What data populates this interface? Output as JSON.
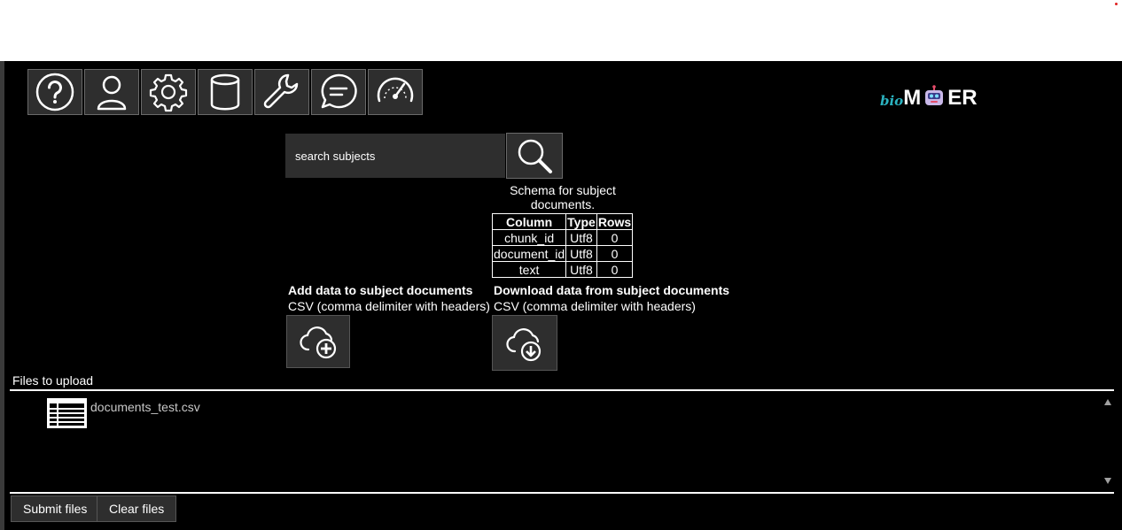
{
  "colors": {
    "background": "#000000",
    "panel": "#2e2e2e",
    "logo_accent": "#2bb3c0"
  },
  "toolbar": {
    "buttons": [
      {
        "icon": "help-icon"
      },
      {
        "icon": "user-icon"
      },
      {
        "icon": "settings-icon"
      },
      {
        "icon": "database-icon"
      },
      {
        "icon": "wrench-icon"
      },
      {
        "icon": "chat-icon"
      },
      {
        "icon": "dashboard-icon"
      }
    ]
  },
  "logo": {
    "prefix": "bio",
    "part1": "M",
    "part2": "ER"
  },
  "search": {
    "placeholder": "search subjects"
  },
  "schema": {
    "caption": "Schema for subject documents.",
    "headers": [
      "Column",
      "Type",
      "Rows"
    ],
    "rows": [
      [
        "chunk_id",
        "Utf8",
        "0"
      ],
      [
        "document_id",
        "Utf8",
        "0"
      ],
      [
        "text",
        "Utf8",
        "0"
      ]
    ]
  },
  "add_data": {
    "title": "Add data to subject documents",
    "subtitle": "CSV (comma delimiter with headers)"
  },
  "download_data": {
    "title": "Download data from subject documents",
    "subtitle": "CSV (comma delimiter with headers)"
  },
  "files": {
    "label": "Files to upload",
    "items": [
      {
        "name": "documents_test.csv"
      }
    ]
  },
  "footer": {
    "submit_label": "Submit files",
    "clear_label": "Clear files"
  }
}
